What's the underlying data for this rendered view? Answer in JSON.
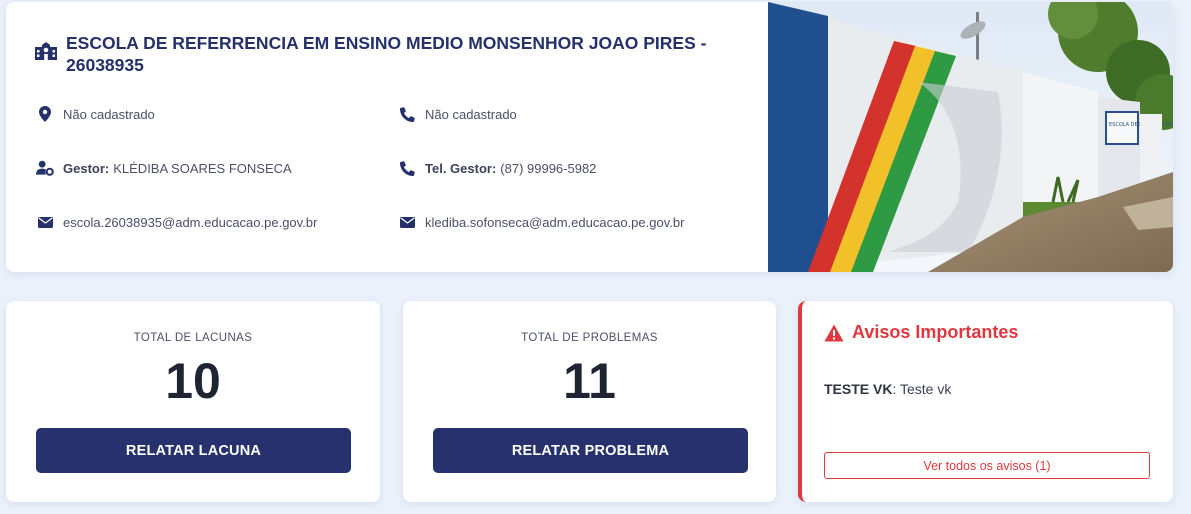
{
  "school": {
    "title": "ESCOLA DE REFERRENCIA EM ENSINO MEDIO MONSENHOR JOAO PIRES - 26038935",
    "address": "Não cadastrado",
    "phone": "Não cadastrado",
    "gestor_label": "Gestor:",
    "gestor_name": "KLÉDIBA SOARES FONSECA",
    "tel_gestor_label": "Tel. Gestor:",
    "tel_gestor": "(87) 99996-5982",
    "school_email": "escola.26038935@adm.educacao.pe.gov.br",
    "gestor_email": "klediba.sofonseca@adm.educacao.pe.gov.br",
    "photo_sign": "ESCOLA DE REFERÊNCIA EM ENSINO MÉDIO"
  },
  "lacunas": {
    "label": "TOTAL DE LACUNAS",
    "value": "10",
    "button": "RELATAR LACUNA"
  },
  "problemas": {
    "label": "TOTAL DE PROBLEMAS",
    "value": "11",
    "button": "RELATAR PROBLEMA"
  },
  "avisos": {
    "title": "Avisos Importantes",
    "item_title": "TESTE VK",
    "item_text": ": Teste vk",
    "button": "Ver todos os avisos (1)"
  },
  "colors": {
    "primary": "#26316d",
    "alert": "#e0383e",
    "background": "#eaf1fb"
  },
  "icons": [
    "school-icon",
    "map-pin-icon",
    "phone-icon",
    "user-cog-icon",
    "envelope-icon",
    "warning-icon"
  ]
}
